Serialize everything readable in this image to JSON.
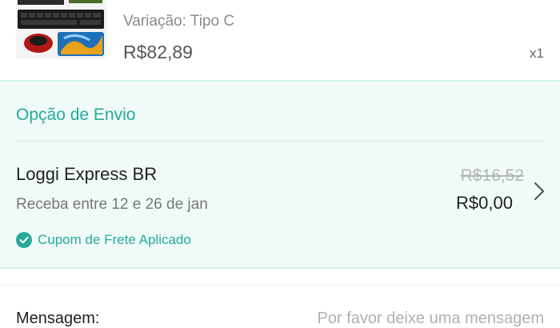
{
  "product": {
    "variation": "Variação: Tipo C",
    "price": "R$82,89",
    "quantity": "x1",
    "thumbnail_icon": "keyboard-mouse-combo-image"
  },
  "shipping": {
    "section_title": "Opção de Envio",
    "carrier": "Loggi Express BR",
    "delivery_estimate": "Receba entre 12 e 26 de jan",
    "original_price": "R$16,52",
    "final_price": "R$0,00",
    "coupon_text": "Cupom de Frete Aplicado",
    "accent_color": "#26aa99"
  },
  "message": {
    "label": "Mensagem:",
    "placeholder": "Por favor deixe uma mensagem"
  }
}
